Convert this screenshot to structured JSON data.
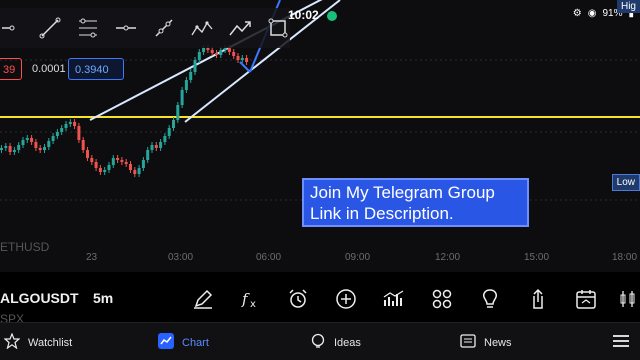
{
  "status": {
    "time": "10:02",
    "battery": "91%"
  },
  "price_labels": {
    "red": "39",
    "plain": "0.0001",
    "blue": "0.3940"
  },
  "right_tags": {
    "high": "Hig",
    "low": "Low"
  },
  "promo": {
    "line1": "Join My Telegram Group",
    "line2": "Link in Description."
  },
  "time_axis": [
    "23",
    "03:00",
    "06:00",
    "09:00",
    "12:00",
    "15:00",
    "18:00"
  ],
  "ghost_symbols": [
    "ETHUSD",
    "SPX"
  ],
  "symbol": {
    "name": "ALGOUSDT",
    "interval": "5m"
  },
  "nav": {
    "watchlist": "Watchlist",
    "chart": "Chart",
    "ideas": "Ideas",
    "news": "News"
  },
  "colors": {
    "accent": "#2962ff",
    "bullish": "#26a69a",
    "bearish": "#ef5350",
    "level_line": "#f5e52a"
  }
}
